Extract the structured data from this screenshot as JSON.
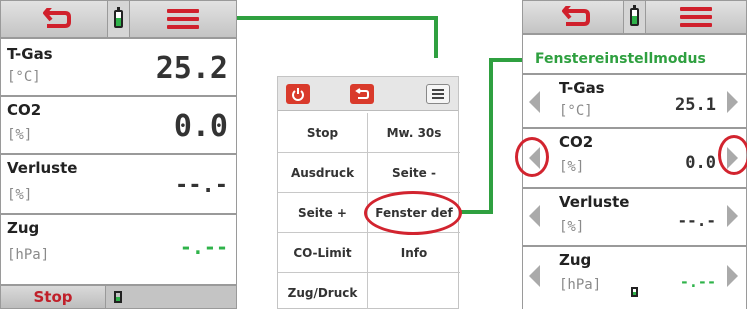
{
  "colors": {
    "accent_red": "#d0202c",
    "green_value": "#2fb34a",
    "connector_green": "#2fa040"
  },
  "left_panel": {
    "rows": [
      {
        "name": "T-Gas",
        "unit": "[°C]",
        "value": "25.2"
      },
      {
        "name": "CO2",
        "unit": "[%]",
        "value": "0.0"
      },
      {
        "name": "Verluste",
        "unit": "[%]",
        "value": "--.-"
      },
      {
        "name": "Zug",
        "unit": "[hPa]",
        "value": "-.--"
      }
    ],
    "stop_label": "Stop"
  },
  "menu_panel": {
    "items": [
      [
        "Stop",
        "Mw. 30s"
      ],
      [
        "Ausdruck",
        "Seite -"
      ],
      [
        "Seite +",
        "Fenster def"
      ],
      [
        "CO-Limit",
        "Info"
      ],
      [
        "Zug/Druck",
        ""
      ]
    ]
  },
  "right_panel": {
    "title": "Fenstereinstellmodus",
    "rows": [
      {
        "name": "T-Gas",
        "unit": "[°C]",
        "value": "25.1"
      },
      {
        "name": "CO2",
        "unit": "[%]",
        "value": "0.0"
      },
      {
        "name": "Verluste",
        "unit": "[%]",
        "value": "--.-"
      },
      {
        "name": "Zug",
        "unit": "[hPa]",
        "value": "-.--"
      }
    ]
  }
}
